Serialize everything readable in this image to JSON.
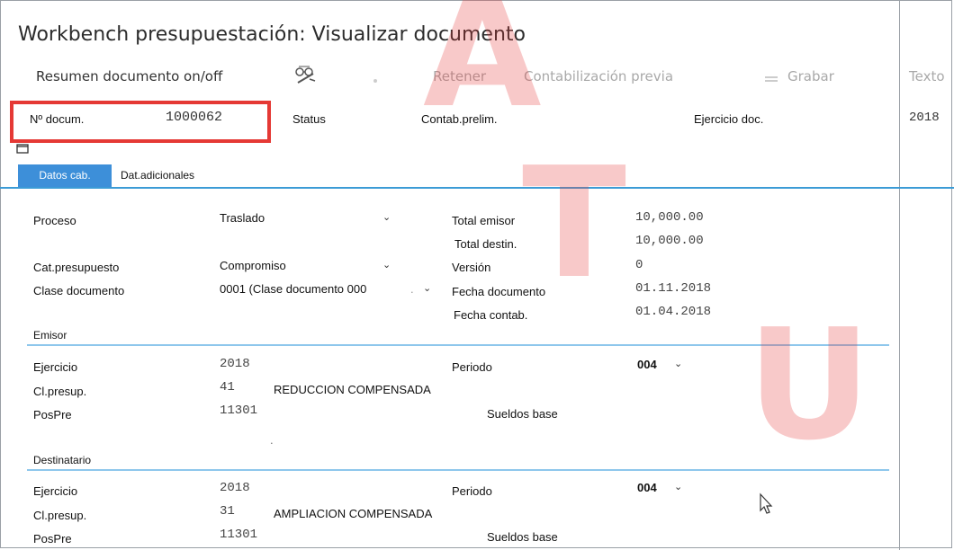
{
  "window": {
    "title": "Workbench presupuestación: Visualizar documento"
  },
  "toolbar": {
    "resumen": "Resumen documento on/off",
    "retener": "Retener",
    "contab_previa": "Contabilización previa",
    "grabar": "Grabar",
    "texto": "Texto"
  },
  "header": {
    "doc_label": "Nº docum.",
    "doc_value": "1000062",
    "status_label": "Status",
    "status_value": "Contab.prelim.",
    "ejercicio_label": "Ejercicio doc.",
    "ejercicio_value": "2018"
  },
  "tabs": [
    {
      "label": "Datos cab.",
      "active": true
    },
    {
      "label": "Dat.adicionales",
      "active": false
    }
  ],
  "main": {
    "proceso_label": "Proceso",
    "proceso_value": "Traslado",
    "catpres_label": "Cat.presupuesto",
    "catpres_value": "Compromiso",
    "clasedoc_label": "Clase documento",
    "clasedoc_value": "0001 (Clase documento 000",
    "total_emisor_label": "Total emisor",
    "total_emisor_value": "10,000.00",
    "total_destin_label": "Total destin.",
    "total_destin_value": "10,000.00",
    "version_label": "Versión",
    "version_value": "0",
    "fecha_doc_label": "Fecha documento",
    "fecha_doc_value": "01.11.2018",
    "fecha_contab_label": "Fecha contab.",
    "fecha_contab_value": "01.04.2018"
  },
  "emisor": {
    "section": "Emisor",
    "ejercicio_label": "Ejercicio",
    "ejercicio_value": "2018",
    "periodo_label": "Periodo",
    "periodo_value": "004",
    "clpres_label": "Cl.presup.",
    "clpres_value": "41",
    "clpres_text": "REDUCCION COMPENSADA",
    "pospre_label": "PosPre",
    "pospre_value": "11301",
    "pospre_text": "Sueldos base"
  },
  "destinatario": {
    "section": "Destinatario",
    "ejercicio_label": "Ejercicio",
    "ejercicio_value": "2018",
    "periodo_label": "Periodo",
    "periodo_value": "004",
    "clpres_label": "Cl.presup.",
    "clpres_value": "31",
    "clpres_text": "AMPLIACION COMPENSADA",
    "pospre_label": "PosPre",
    "pospre_value": "11301",
    "pospre_text": "Sueldos base"
  },
  "watermark": {
    "letters": [
      "A",
      "T",
      "U"
    ]
  },
  "colors": {
    "accent": "#3d8fd9",
    "highlight": "#e53935",
    "section_line": "#8ec7ec"
  }
}
